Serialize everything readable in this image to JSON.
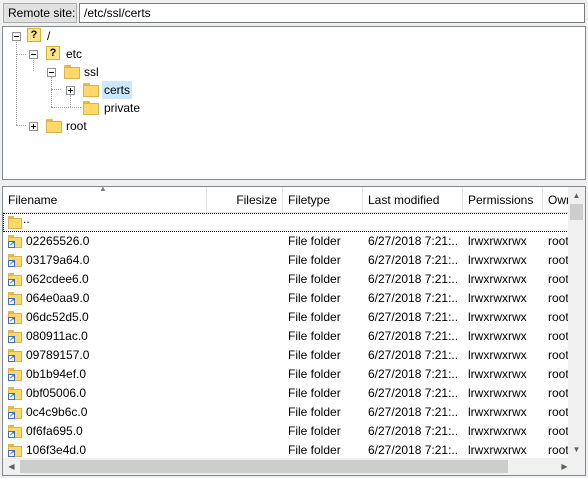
{
  "remote_site": {
    "label": "Remote site:",
    "path": "/etc/ssl/certs"
  },
  "tree": {
    "root_label": "/",
    "etc_label": "etc",
    "ssl_label": "ssl",
    "certs_label": "certs",
    "private_label": "private",
    "rootdir_label": "root"
  },
  "list": {
    "columns": [
      "Filename",
      "Filesize",
      "Filetype",
      "Last modified",
      "Permissions",
      "Owner/Group"
    ],
    "parent_label": "..",
    "rows": [
      {
        "name": "02265526.0",
        "type": "File folder",
        "modified": "6/27/2018 7:21:...",
        "perms": "lrwxrwxrwx",
        "owner": "root"
      },
      {
        "name": "03179a64.0",
        "type": "File folder",
        "modified": "6/27/2018 7:21:...",
        "perms": "lrwxrwxrwx",
        "owner": "root"
      },
      {
        "name": "062cdee6.0",
        "type": "File folder",
        "modified": "6/27/2018 7:21:...",
        "perms": "lrwxrwxrwx",
        "owner": "root"
      },
      {
        "name": "064e0aa9.0",
        "type": "File folder",
        "modified": "6/27/2018 7:21:...",
        "perms": "lrwxrwxrwx",
        "owner": "root"
      },
      {
        "name": "06dc52d5.0",
        "type": "File folder",
        "modified": "6/27/2018 7:21:...",
        "perms": "lrwxrwxrwx",
        "owner": "root"
      },
      {
        "name": "080911ac.0",
        "type": "File folder",
        "modified": "6/27/2018 7:21:...",
        "perms": "lrwxrwxrwx",
        "owner": "root"
      },
      {
        "name": "09789157.0",
        "type": "File folder",
        "modified": "6/27/2018 7:21:...",
        "perms": "lrwxrwxrwx",
        "owner": "root"
      },
      {
        "name": "0b1b94ef.0",
        "type": "File folder",
        "modified": "6/27/2018 7:21:...",
        "perms": "lrwxrwxrwx",
        "owner": "root"
      },
      {
        "name": "0bf05006.0",
        "type": "File folder",
        "modified": "6/27/2018 7:21:...",
        "perms": "lrwxrwxrwx",
        "owner": "root"
      },
      {
        "name": "0c4c9b6c.0",
        "type": "File folder",
        "modified": "6/27/2018 7:21:...",
        "perms": "lrwxrwxrwx",
        "owner": "root"
      },
      {
        "name": "0f6fa695.0",
        "type": "File folder",
        "modified": "6/27/2018 7:21:...",
        "perms": "lrwxrwxrwx",
        "owner": "root"
      },
      {
        "name": "106f3e4d.0",
        "type": "File folder",
        "modified": "6/27/2018 7:21:...",
        "perms": "lrwxrwxrwx",
        "owner": "root"
      }
    ]
  },
  "icons": {
    "folder": "folder-icon",
    "unknown_folder": "question-folder-icon",
    "symlink": "symlink-badge-icon"
  }
}
